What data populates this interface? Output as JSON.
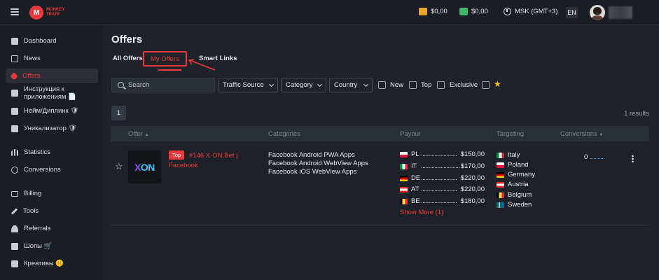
{
  "header": {
    "logo": {
      "mark": "M",
      "text": "MONKEY TRAFF"
    },
    "balance1": "$0,00",
    "balance2": "$0,00",
    "timezone": "MSK (GMT+3)",
    "lang": "EN"
  },
  "sidebar": {
    "items": [
      {
        "label": "Dashboard",
        "icon": "dashboard-icon"
      },
      {
        "label": "News",
        "icon": "news-icon"
      },
      {
        "label": "Offers",
        "icon": "tag-icon",
        "active": true
      },
      {
        "label": "Инструкция к",
        "label2": "приложениям 📄",
        "icon": "document-icon"
      },
      {
        "label": "Нейм/Диплинк 🛡",
        "icon": "document-icon"
      },
      {
        "label": "Уникализатор 🛡",
        "icon": "document-icon"
      },
      {
        "label": "Statistics",
        "icon": "bar-chart-icon"
      },
      {
        "label": "Conversions",
        "icon": "target-icon"
      },
      {
        "label": "Billing",
        "icon": "card-icon"
      },
      {
        "label": "Tools",
        "icon": "wrench-icon"
      },
      {
        "label": "Referrals",
        "icon": "users-icon"
      },
      {
        "label": "Шопы 🛒",
        "icon": "document-icon"
      },
      {
        "label": "Креативы 🤫",
        "icon": "document-icon"
      }
    ]
  },
  "page": {
    "title": "Offers",
    "tabs": [
      {
        "label": "All Offers"
      },
      {
        "label": "My Offers",
        "active": true
      },
      {
        "label": "Smart Links"
      }
    ]
  },
  "filters": {
    "search_placeholder": "Search",
    "traffic_source": "Traffic Source",
    "category": "Category",
    "country": "Country",
    "new": "New",
    "top": "Top",
    "exclusive": "Exclusive",
    "favorite_icon": "star-icon"
  },
  "pagination": {
    "current": "1",
    "results": "1 results"
  },
  "table": {
    "headers": [
      "Offer",
      "Categories",
      "Payout",
      "Targeting",
      "Conversions"
    ],
    "sort_indicator_offer": "▲",
    "sort_indicator_conv": "▼",
    "rows": [
      {
        "image_text_x": "X",
        "image_text_on": "ON",
        "badge": "Top",
        "name": "#146 X-ON.Bet | Facebook",
        "categories": [
          "Facebook Android PWA Apps",
          "Facebook Android WebView Apps",
          "Facebook iOS WebView Apps"
        ],
        "payouts": [
          {
            "geo": "PL",
            "dots": "........................",
            "amount": "$150,00"
          },
          {
            "geo": "IT",
            "dots": "..........................",
            "amount": "$170,00"
          },
          {
            "geo": "DE",
            "dots": "........................",
            "amount": "$220,00"
          },
          {
            "geo": "AT",
            "dots": "........................",
            "amount": "$220,00"
          },
          {
            "geo": "BE",
            "dots": "........................",
            "amount": "$180,00"
          }
        ],
        "show_more": "Show More (1)",
        "targeting": [
          "Italy",
          "Poland",
          "Germany",
          "Austria",
          "Belgium",
          "Sweden"
        ],
        "conversions": "0"
      }
    ]
  },
  "colors": {
    "accent": "#e8393f",
    "background": "#1f2329",
    "wallet1": "#e8a531",
    "wallet2": "#3fb56a"
  }
}
